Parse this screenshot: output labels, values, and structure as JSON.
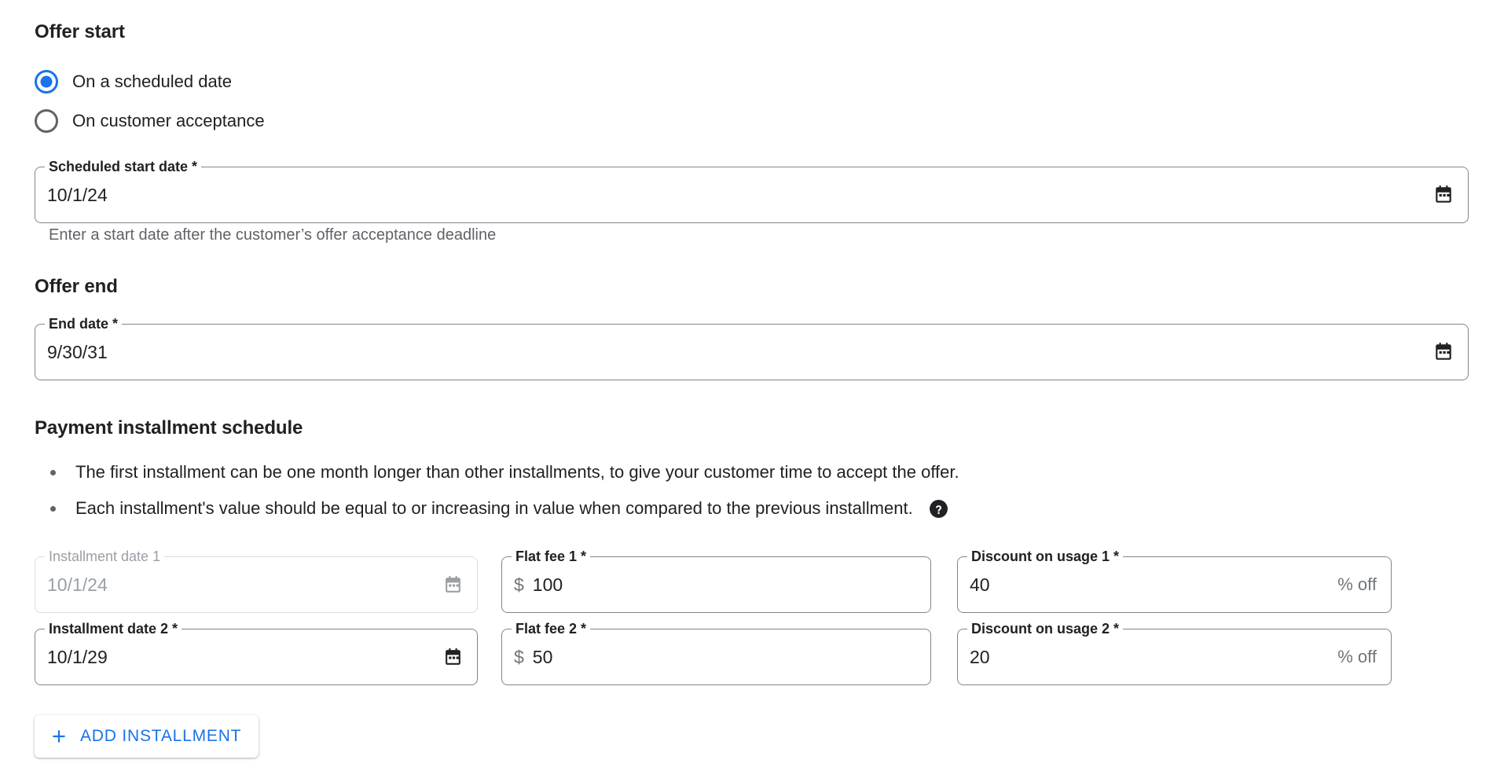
{
  "offer_start": {
    "heading": "Offer start",
    "options": [
      {
        "label": "On a scheduled date",
        "selected": true
      },
      {
        "label": "On customer acceptance",
        "selected": false
      }
    ],
    "scheduled_start_date": {
      "label": "Scheduled start date *",
      "value": "10/1/24",
      "icon": "calendar-icon"
    },
    "helper_text": "Enter a start date after the customer’s offer acceptance deadline"
  },
  "offer_end": {
    "heading": "Offer end",
    "end_date": {
      "label": "End date *",
      "value": "9/30/31",
      "icon": "calendar-icon"
    }
  },
  "payment_schedule": {
    "heading": "Payment installment schedule",
    "bullets": [
      {
        "text": "The first installment can be one month longer than other installments, to give your customer time to accept the offer.",
        "has_help_icon": false
      },
      {
        "text": "Each installment's value should be equal to or increasing in value when compared to the previous installment.",
        "has_help_icon": true
      }
    ],
    "help_icon": "help-icon",
    "columns": [
      "installment_date",
      "flat_fee",
      "discount_on_usage"
    ],
    "rows": [
      {
        "installment_date": {
          "label": "Installment date 1",
          "value": "10/1/24",
          "disabled": true,
          "icon": "calendar-icon"
        },
        "flat_fee": {
          "label": "Flat fee 1 *",
          "prefix": "$",
          "value": "100",
          "disabled": false
        },
        "discount_on_usage": {
          "label": "Discount on usage 1 *",
          "value": "40",
          "suffix": "% off",
          "disabled": false
        }
      },
      {
        "installment_date": {
          "label": "Installment date 2 *",
          "value": "10/1/29",
          "disabled": false,
          "icon": "calendar-icon"
        },
        "flat_fee": {
          "label": "Flat fee 2 *",
          "prefix": "$",
          "value": "50",
          "disabled": false
        },
        "discount_on_usage": {
          "label": "Discount on usage 2 *",
          "value": "20",
          "suffix": "% off",
          "disabled": false
        }
      }
    ],
    "add_installment_button": {
      "label": "ADD INSTALLMENT",
      "icon": "plus-icon"
    }
  },
  "colors": {
    "accent": "#1a73e8",
    "text_primary": "#202124",
    "text_secondary": "#5f6368",
    "text_disabled": "#9aa0a6",
    "border": "#80868b",
    "border_disabled": "#dadce0"
  }
}
